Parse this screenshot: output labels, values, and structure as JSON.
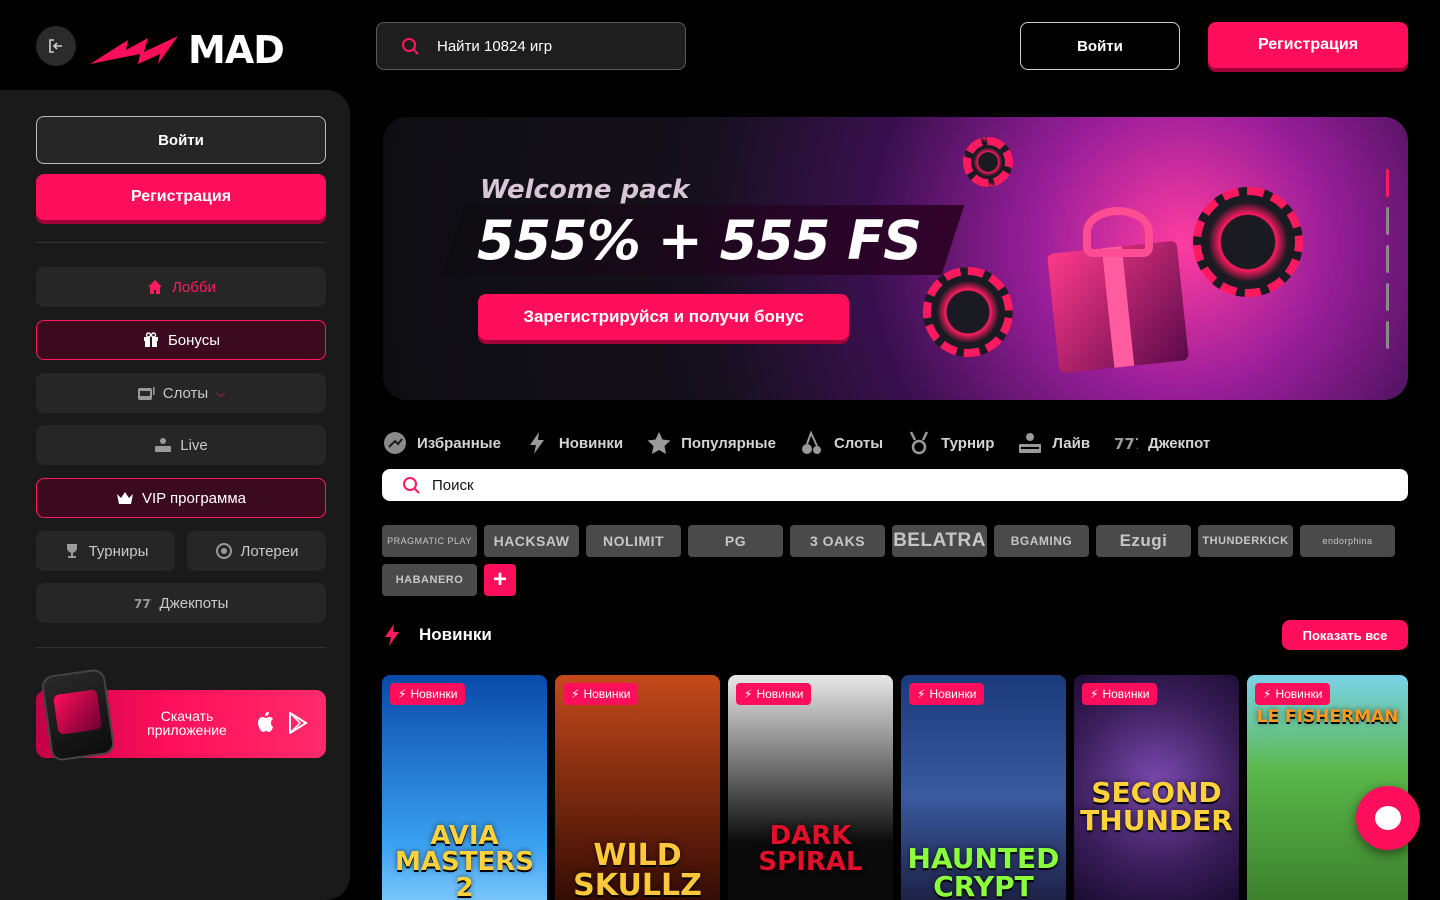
{
  "header": {
    "logo_text": "MAD",
    "search_placeholder": "Найти 10824 игр",
    "login_label": "Войти",
    "register_label": "Регистрация"
  },
  "sidebar": {
    "login_label": "Войти",
    "register_label": "Регистрация",
    "nav": [
      {
        "label": "Лобби",
        "icon": "home-icon"
      },
      {
        "label": "Бонусы",
        "icon": "gift-icon"
      },
      {
        "label": "Слоты",
        "icon": "slot-machine-icon"
      },
      {
        "label": "Live",
        "icon": "dealer-icon"
      },
      {
        "label": "VIP программа",
        "icon": "crown-icon"
      },
      {
        "label": "Турниры",
        "icon": "trophy-icon"
      },
      {
        "label": "Лотереи",
        "icon": "lottery-icon"
      },
      {
        "label": "Джекпоты",
        "icon": "jackpot-icon"
      }
    ],
    "app_banner_text": "Скачать приложение"
  },
  "hero": {
    "subtitle": "Welcome pack",
    "title": "555% + 555 FS",
    "cta_label": "Зарегистрируйся и получи бонус",
    "slides_count": 5,
    "active_slide": 1
  },
  "categories": [
    {
      "label": "Избранные",
      "icon": "favorites-icon"
    },
    {
      "label": "Новинки",
      "icon": "lightning-icon"
    },
    {
      "label": "Популярные",
      "icon": "star-icon"
    },
    {
      "label": "Слоты",
      "icon": "cherry-icon"
    },
    {
      "label": "Турнир",
      "icon": "trophy-icon"
    },
    {
      "label": "Лайв",
      "icon": "dealer-icon"
    },
    {
      "label": "Джекпот",
      "icon": "jackpot-icon"
    }
  ],
  "game_search_placeholder": "Поиск",
  "providers": [
    "PRAGMATIC PLAY",
    "HACKSAW",
    "NOLIMIT",
    "PG",
    "3 OAKS",
    "BELATRA",
    "BGAMING",
    "Ezugi",
    "THUNDERKICK",
    "endorphina",
    "HABANERO"
  ],
  "section": {
    "title": "Новинки",
    "show_all_label": "Показать все"
  },
  "games": [
    {
      "title": "AVIA MASTERS 2",
      "badge": "Новинки",
      "bg": "#1a6fd6",
      "title_color": "#ffd23c"
    },
    {
      "title": "WILD SKULLZ",
      "badge": "Новинки",
      "bg": "#7a2a10",
      "title_color": "#ffc83c"
    },
    {
      "title": "DARK SPIRAL",
      "badge": "Новинки",
      "bg": "#1a1a1a",
      "title_color": "#e0102a"
    },
    {
      "title": "HAUNTED CRYPT",
      "badge": "Новинки",
      "bg": "#1a3a6a",
      "title_color": "#8cff3c"
    },
    {
      "title": "SECOND THUNDER",
      "badge": "Новинки",
      "bg": "#3a1e5a",
      "title_color": "#ffd23c"
    },
    {
      "title": "LE FISHERMAN",
      "badge": "Новинки",
      "bg": "#5ab84a",
      "title_color": "#ff9a1e"
    }
  ],
  "colors": {
    "accent": "#ff0f5b",
    "sidebar_bg": "#1a1a1a",
    "page_bg": "#000000"
  }
}
